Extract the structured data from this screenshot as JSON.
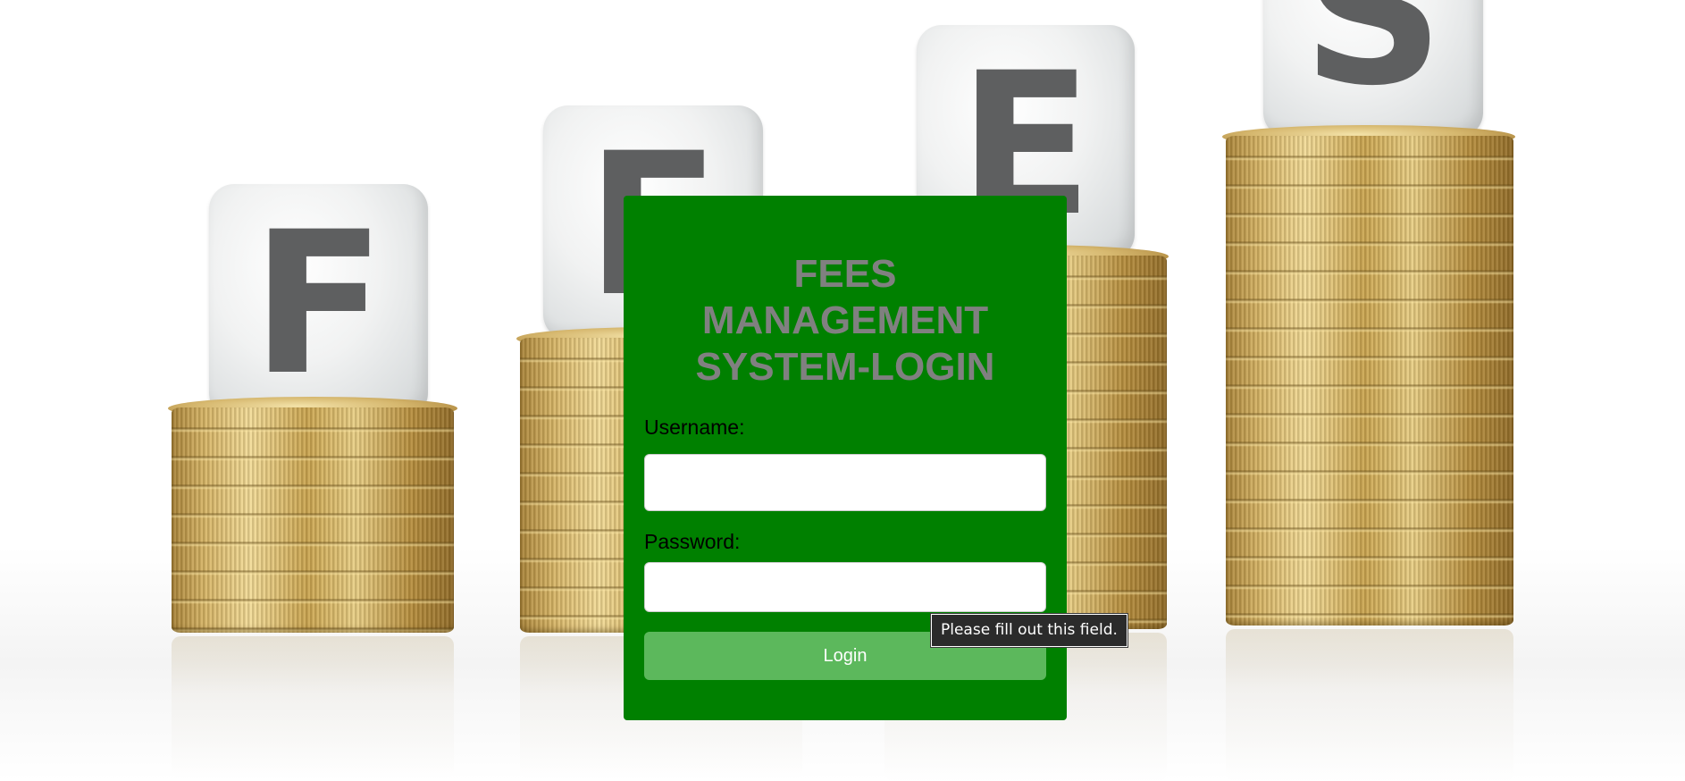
{
  "background": {
    "dice_letters": [
      "F",
      "E",
      "E",
      "S"
    ]
  },
  "login": {
    "title": "FEES MANAGEMENT SYSTEM-LOGIN",
    "username_label": "Username:",
    "username_value": "",
    "password_label": "Password:",
    "password_value": "",
    "login_button_label": "Login"
  },
  "validation": {
    "tooltip_text": "Please fill out this field."
  },
  "colors": {
    "panel_background": "#008000",
    "title_text": "#808080",
    "login_button": "#5cb85c",
    "tooltip_background": "#2b2b2b"
  }
}
